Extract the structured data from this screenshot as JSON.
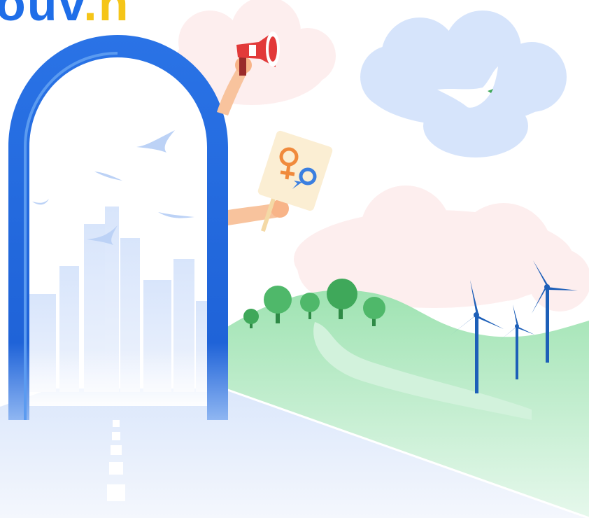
{
  "logo": {
    "part1": "ouv",
    "dot": ".",
    "part2": "n"
  },
  "colors": {
    "brand_blue": "#1f6ee8",
    "brand_yellow": "#f5c518",
    "hill_green": "#a8e7b9",
    "tree_green": "#3fa85a",
    "sign_female": "#f08a3c",
    "sign_male": "#3b7fe0",
    "megaphone_red": "#e23a3a",
    "turbine_blue": "#1d5fb8"
  },
  "icons": [
    "megaphone-icon",
    "gender-sign-icon",
    "dove-icon",
    "bird-icon",
    "tree-icon",
    "wind-turbine-icon",
    "city-skyline-icon"
  ]
}
